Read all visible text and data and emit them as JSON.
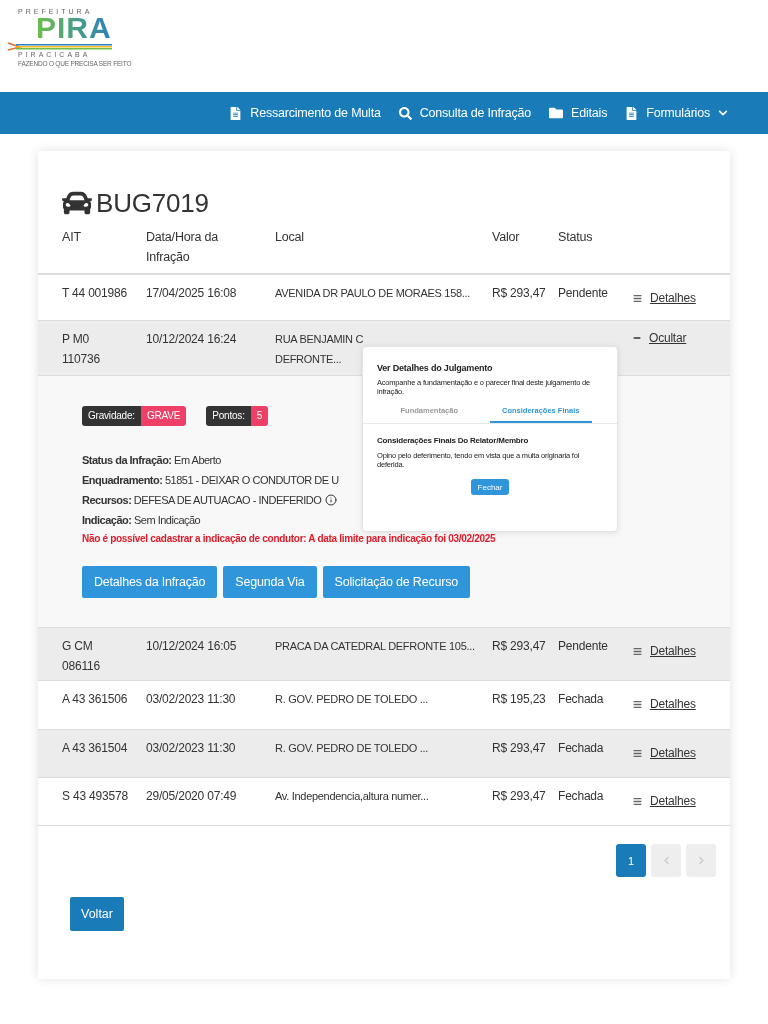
{
  "logo": {
    "top": "PREFEITURA",
    "main": "PIRA",
    "city": "PIRACICABA",
    "tagline": "FAZENDO O QUE PRECISA SER FEITO"
  },
  "nav": [
    {
      "label": "Ressarcimento de Multa",
      "kind": "document"
    },
    {
      "label": "Consulta de Infração",
      "kind": "search"
    },
    {
      "label": "Editais",
      "kind": "folder"
    },
    {
      "label": "Formulários",
      "kind": "document",
      "dropdown": true
    }
  ],
  "vehicle": {
    "plate": "BUG7019"
  },
  "table": {
    "columns": [
      "AIT",
      "Data/Hora da Infração",
      "Local",
      "Valor",
      "Status"
    ],
    "rows": [
      {
        "ait": "T 44 001986",
        "date": "17/04/2025 16:08",
        "local": "AVENIDA DR PAULO DE MORAES 158...",
        "valor": "R$ 293,47",
        "status": "Pendente",
        "action": "Detalhes",
        "expanded": false
      },
      {
        "ait": "P M0\n110736",
        "date": "10/12/2024 16:24",
        "local": "RUA BENJAMIN C\nDEFRONTE...",
        "action": "Ocultar",
        "expanded": true
      },
      {
        "ait": "G CM\n086116",
        "date": "10/12/2024 16:05",
        "local": "PRACA DA CATEDRAL DEFRONTE 105...",
        "valor": "R$ 293,47",
        "status": "Pendente",
        "action": "Detalhes",
        "expanded": false
      },
      {
        "ait": "A 43 361506",
        "date": "03/02/2023 11:30",
        "local": "R. GOV. PEDRO DE TOLEDO ...",
        "valor": "R$ 195,23",
        "status": "Fechada",
        "action": "Detalhes",
        "expanded": false
      },
      {
        "ait": "A 43 361504",
        "date": "03/02/2023 11:30",
        "local": "R. GOV. PEDRO DE TOLEDO ...",
        "valor": "R$ 293,47",
        "status": "Fechada",
        "action": "Detalhes",
        "expanded": false
      },
      {
        "ait": "S 43 493578",
        "date": "29/05/2020 07:49",
        "local": "Av. Independencia,altura numer...",
        "valor": "R$ 293,47",
        "status": "Fechada",
        "action": "Detalhes",
        "expanded": false
      }
    ]
  },
  "details": {
    "badges": [
      {
        "label": "Gravidade:",
        "value": "GRAVE"
      },
      {
        "label": "Pontos:",
        "value": "5"
      }
    ],
    "fields": [
      {
        "label": "Status da Infração:",
        "value": "Em Aberto"
      },
      {
        "label": "Enquadramento:",
        "value": "51851 - DEIXAR O CONDUTOR DE U"
      },
      {
        "label": "Recursos:",
        "value": "DEFESA DE AUTUACAO - INDEFERIDO",
        "info": true
      },
      {
        "label": "Indicação:",
        "value": "Sem Indicação"
      }
    ],
    "warning": "Não é possível cadastrar a indicação de condutor: A data limite para indicação foi 03/02/2025",
    "buttons": [
      "Detalhes da Infração",
      "Segunda Via",
      "Solicitação de Recurso"
    ]
  },
  "popup": {
    "title": "Ver Detalhes do Julgamento",
    "subtitle": "Acompanhe a fundamentação e o parecer final deste julgamento de infração.",
    "tabs": [
      {
        "label": "Fundamentação",
        "selected": false
      },
      {
        "label": "Considerações Finais",
        "selected": true
      }
    ],
    "heading": "Considerações Finais Do Relator/Membro",
    "text": "Opino pelo deferimento, tendo em vista que a multa originaria foi deferida.",
    "button": "Fechar"
  },
  "pagination": {
    "pages": [
      {
        "label": "1",
        "selected": true
      }
    ],
    "prev_disabled": true,
    "next_disabled": true
  },
  "back_button": "Voltar"
}
